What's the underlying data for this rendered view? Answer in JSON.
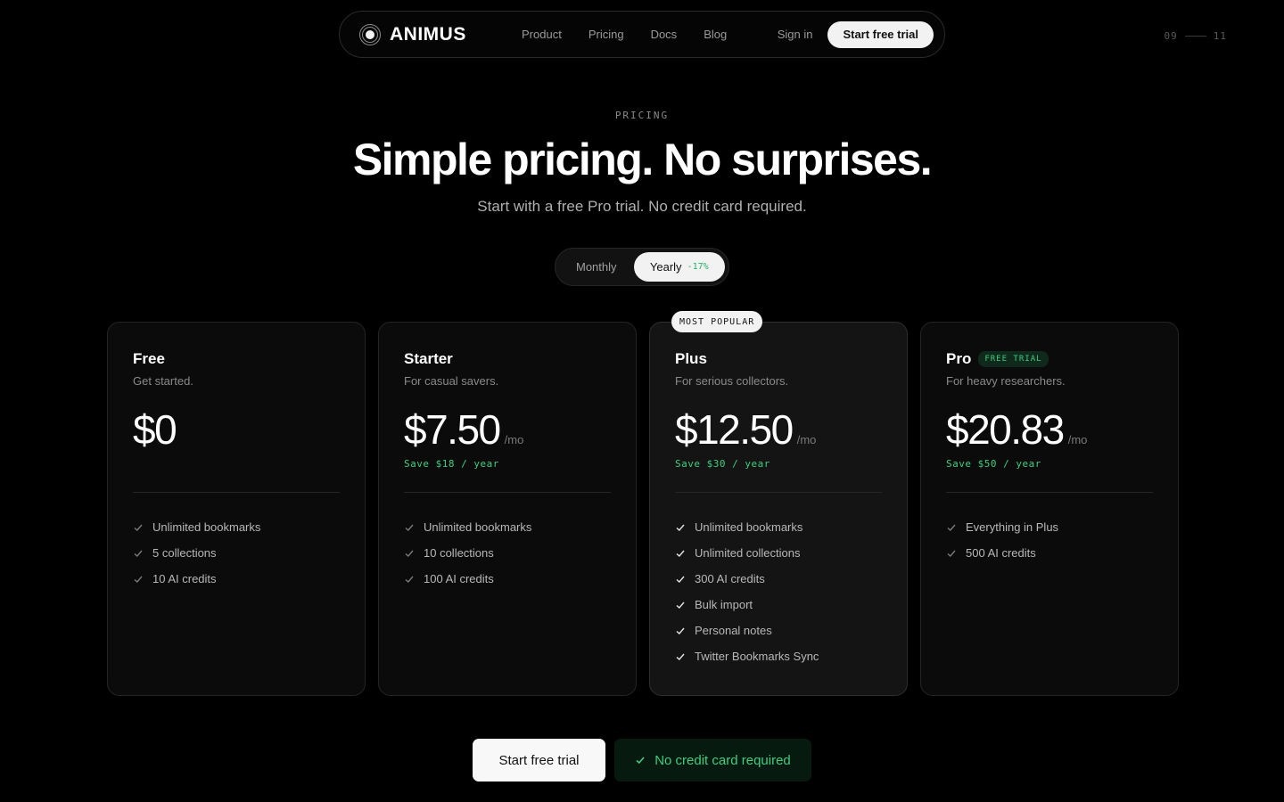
{
  "nav": {
    "logo_text": "ANIMUS",
    "links": [
      "Product",
      "Pricing",
      "Docs",
      "Blog"
    ],
    "signin": "Sign in",
    "cta": "Start free trial"
  },
  "pager": {
    "current": "09",
    "total": "11"
  },
  "hero": {
    "eyebrow": "PRICING",
    "title": "Simple pricing. No surprises.",
    "subtitle": "Start with a free Pro trial. No credit card required."
  },
  "billing_toggle": {
    "monthly": "Monthly",
    "yearly": "Yearly",
    "discount": "-17%",
    "selected": "yearly"
  },
  "plans": [
    {
      "name": "Free",
      "tag": "",
      "desc": "Get started.",
      "price": "$0",
      "per": "",
      "save": "",
      "features": [
        "Unlimited bookmarks",
        "5 collections",
        "10 AI credits"
      ]
    },
    {
      "name": "Starter",
      "tag": "",
      "desc": "For casual savers.",
      "price": "$7.50",
      "per": "/mo",
      "save": "Save $18 / year",
      "features": [
        "Unlimited bookmarks",
        "10 collections",
        "100 AI credits"
      ]
    },
    {
      "name": "Plus",
      "tag": "",
      "desc": "For serious collectors.",
      "price": "$12.50",
      "per": "/mo",
      "save": "Save $30 / year",
      "badge": "MOST POPULAR",
      "features": [
        "Unlimited bookmarks",
        "Unlimited collections",
        "300 AI credits",
        "Bulk import",
        "Personal notes",
        "Twitter Bookmarks Sync"
      ]
    },
    {
      "name": "Pro",
      "tag": "FREE TRIAL",
      "desc": "For heavy researchers.",
      "price": "$20.83",
      "per": "/mo",
      "save": "Save $50 / year",
      "features": [
        "Everything in Plus",
        "500 AI credits"
      ]
    }
  ],
  "bottom": {
    "cta": "Start free trial",
    "note": "No credit card required"
  },
  "colors": {
    "background": "#000000",
    "accent_green": "#3ccf7e",
    "card": "#0b0b0b",
    "card_featured": "#141414"
  }
}
